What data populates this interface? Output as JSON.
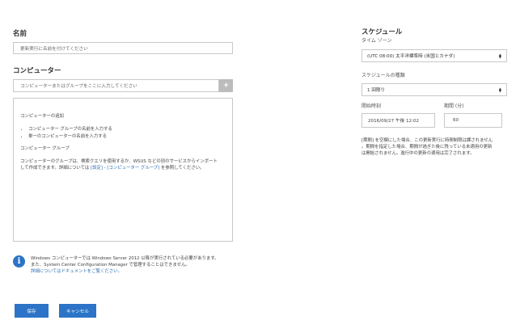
{
  "name": {
    "label": "名前",
    "placeholder": "更新実行に名前を付けてください"
  },
  "computers": {
    "label": "コンピューター",
    "placeholder": "コンピューターまたはグループをここに入力してください",
    "add_symbol": "+",
    "panel": {
      "add_title": "コンピューターの追加",
      "bullets": [
        "コンピューター グループの名前を入力する",
        "単一のコンピューターの名前を入力する"
      ],
      "group_title": "コンピューター グループ",
      "group_desc_1": "コンピューターのグループは、検索クエリを使用するか、WSUS などの別のサービスからインポート",
      "group_desc_2_prefix": "して作成できます。詳細については ",
      "link_settings": "[設定]",
      "group_desc_sep": " - ",
      "link_groups": "[コンピューター グループ]",
      "group_desc_suffix": " を参照してください。"
    }
  },
  "info": {
    "icon": "info-icon",
    "line1": "Windows コンピューターでは Windows Server 2012 以降が実行されている必要があります。",
    "line2": "また、System Center Configuration Manager で管理することはできません。",
    "link": "詳細についてはドキュメントをご覧ください。"
  },
  "buttons": {
    "save": "保存",
    "cancel": "キャンセル"
  },
  "schedule": {
    "title": "スケジュール",
    "timezone_label": "タイム ゾーン",
    "timezone_value": "(UTC 08:00) 太平洋標準時 (米国とカナダ)",
    "type_label": "スケジュールの種類",
    "type_value": "1 回限り",
    "start_label": "開始時刻",
    "start_value": "2016/09/27 午後 12:02",
    "duration_label": "期間 (分)",
    "duration_value": "60",
    "note_1": "[期間] を空欄にした場合、この更新実行に時間制限は課されませ",
    "note_1_end": "ん",
    "note_2": "。期間を指定した場合、期間が過ぎた後に残っている未適用の更新",
    "note_3": "は開始されません。進行中の更新の適用は完了されます。"
  },
  "colors": {
    "accent": "#2b74c7",
    "link": "#2f6fb5",
    "border": "#c8c8c8"
  }
}
